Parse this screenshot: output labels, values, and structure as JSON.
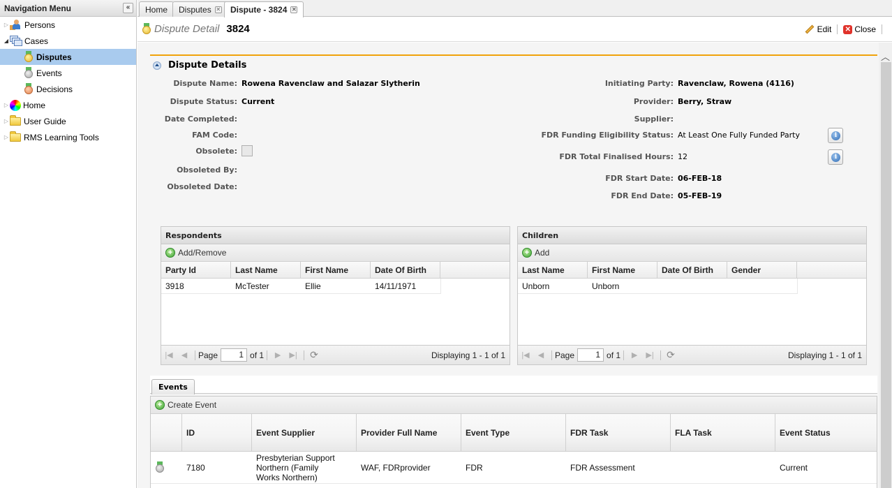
{
  "sidebar": {
    "title": "Navigation Menu",
    "collapse_label": "«",
    "items": [
      {
        "label": "Persons",
        "icon": "persons-icon"
      },
      {
        "label": "Cases",
        "icon": "cases-icon"
      },
      {
        "label": "Disputes",
        "icon": "gold-medal-icon",
        "selected": true
      },
      {
        "label": "Events",
        "icon": "silver-medal-icon"
      },
      {
        "label": "Decisions",
        "icon": "bronze-medal-icon"
      },
      {
        "label": "Home",
        "icon": "color-wheel-icon"
      },
      {
        "label": "User Guide",
        "icon": "folder-icon"
      },
      {
        "label": "RMS Learning Tools",
        "icon": "folder-icon"
      }
    ]
  },
  "tabs": [
    {
      "label": "Home"
    },
    {
      "label": "Disputes"
    },
    {
      "label": "Dispute - 3824",
      "active": true
    }
  ],
  "header": {
    "label": "Dispute Detail",
    "id": "3824",
    "edit_label": "Edit",
    "close_label": "Close"
  },
  "details": {
    "section_title": "Dispute Details",
    "left": [
      {
        "label": "Dispute Name:",
        "value": "Rowena Ravenclaw and Salazar Slytherin"
      },
      {
        "label": "Dispute Status:",
        "value": "Current"
      },
      {
        "label": "Date Completed:",
        "value": ""
      },
      {
        "label": "FAM Code:",
        "value": ""
      },
      {
        "label": "Obsolete:",
        "value": "",
        "checked": false
      },
      {
        "label": "Obsoleted By:",
        "value": ""
      },
      {
        "label": "Obsoleted Date:",
        "value": ""
      }
    ],
    "right": [
      {
        "label": "Initiating Party:",
        "value": "Ravenclaw, Rowena (4116)"
      },
      {
        "label": "Provider:",
        "value": "Berry, Straw"
      },
      {
        "label": "Supplier:",
        "value": ""
      },
      {
        "label": "FDR Funding Eligibility Status:",
        "value": "At Least One Fully Funded Party"
      },
      {
        "label": "FDR Total Finalised Hours:",
        "value": "12"
      },
      {
        "label": "FDR Start Date:",
        "value": "06-FEB-18"
      },
      {
        "label": "FDR End Date:",
        "value": "05-FEB-19"
      }
    ]
  },
  "respondents": {
    "title": "Respondents",
    "action": "Add/Remove",
    "columns": [
      "Party Id",
      "Last Name",
      "First Name",
      "Date Of Birth"
    ],
    "rows": [
      [
        "3918",
        "McTester",
        "Ellie",
        "14/11/1971"
      ]
    ],
    "pager": {
      "page_label": "Page",
      "page": "1",
      "of": "of 1",
      "display": "Displaying 1 - 1 of 1"
    }
  },
  "children": {
    "title": "Children",
    "action": "Add",
    "columns": [
      "Last Name",
      "First Name",
      "Date Of Birth",
      "Gender"
    ],
    "rows": [
      [
        "Unborn",
        "Unborn",
        "",
        ""
      ]
    ],
    "pager": {
      "page_label": "Page",
      "page": "1",
      "of": "of 1",
      "display": "Displaying 1 - 1 of 1"
    }
  },
  "events": {
    "tab_label": "Events",
    "action": "Create Event",
    "columns": [
      "",
      "ID",
      "Event Supplier",
      "Provider Full Name",
      "Event Type",
      "FDR Task",
      "FLA Task",
      "Event Status"
    ],
    "rows": [
      {
        "icon": "silver-medal-icon",
        "id": "7180",
        "supplier": "Presbyterian Support Northern (Family Works Northern)",
        "provider": "WAF, FDRprovider",
        "type": "FDR",
        "fdr_task": "FDR Assessment",
        "fla_task": "",
        "status": "Current"
      }
    ]
  }
}
